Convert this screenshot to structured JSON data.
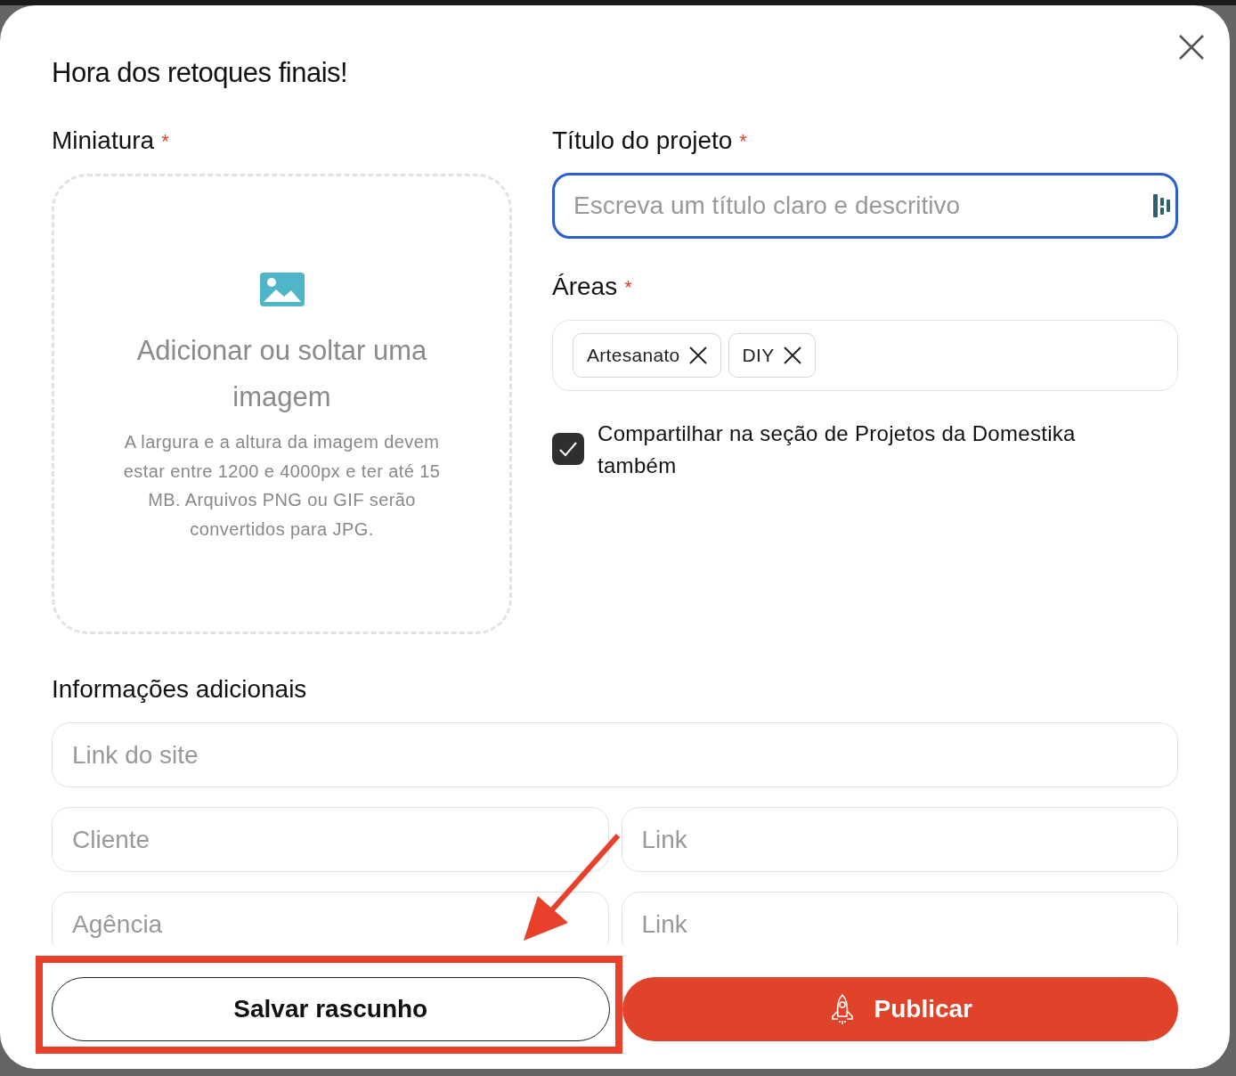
{
  "dialog": {
    "title": "Hora dos retoques finais!"
  },
  "thumbnail": {
    "label": "Miniatura",
    "required_mark": "*",
    "upload_title": "Adicionar ou soltar uma imagem",
    "upload_hint": "A largura e a altura da imagem devem estar entre 1200 e 4000px e ter até 15 MB. Arquivos PNG ou GIF serão convertidos para JPG."
  },
  "project_title": {
    "label": "Título do projeto",
    "required_mark": "*",
    "placeholder": "Escreva um título claro e descritivo",
    "focused": true
  },
  "areas": {
    "label": "Áreas",
    "required_mark": "*",
    "tags": [
      "Artesanato",
      "DIY"
    ]
  },
  "share": {
    "label": "Compartilhar na seção de Projetos da Domestika também",
    "checked": true
  },
  "additional": {
    "label": "Informações adicionais",
    "rows": [
      [
        {
          "placeholder": "Link do site"
        }
      ],
      [
        {
          "placeholder": "Cliente"
        },
        {
          "placeholder": "Link"
        }
      ],
      [
        {
          "placeholder": "Agência"
        },
        {
          "placeholder": "Link"
        }
      ]
    ]
  },
  "buttons": [
    {
      "kind": "secondary",
      "label": "Salvar rascunho"
    },
    {
      "kind": "primary",
      "label": "Publicar"
    }
  ]
}
